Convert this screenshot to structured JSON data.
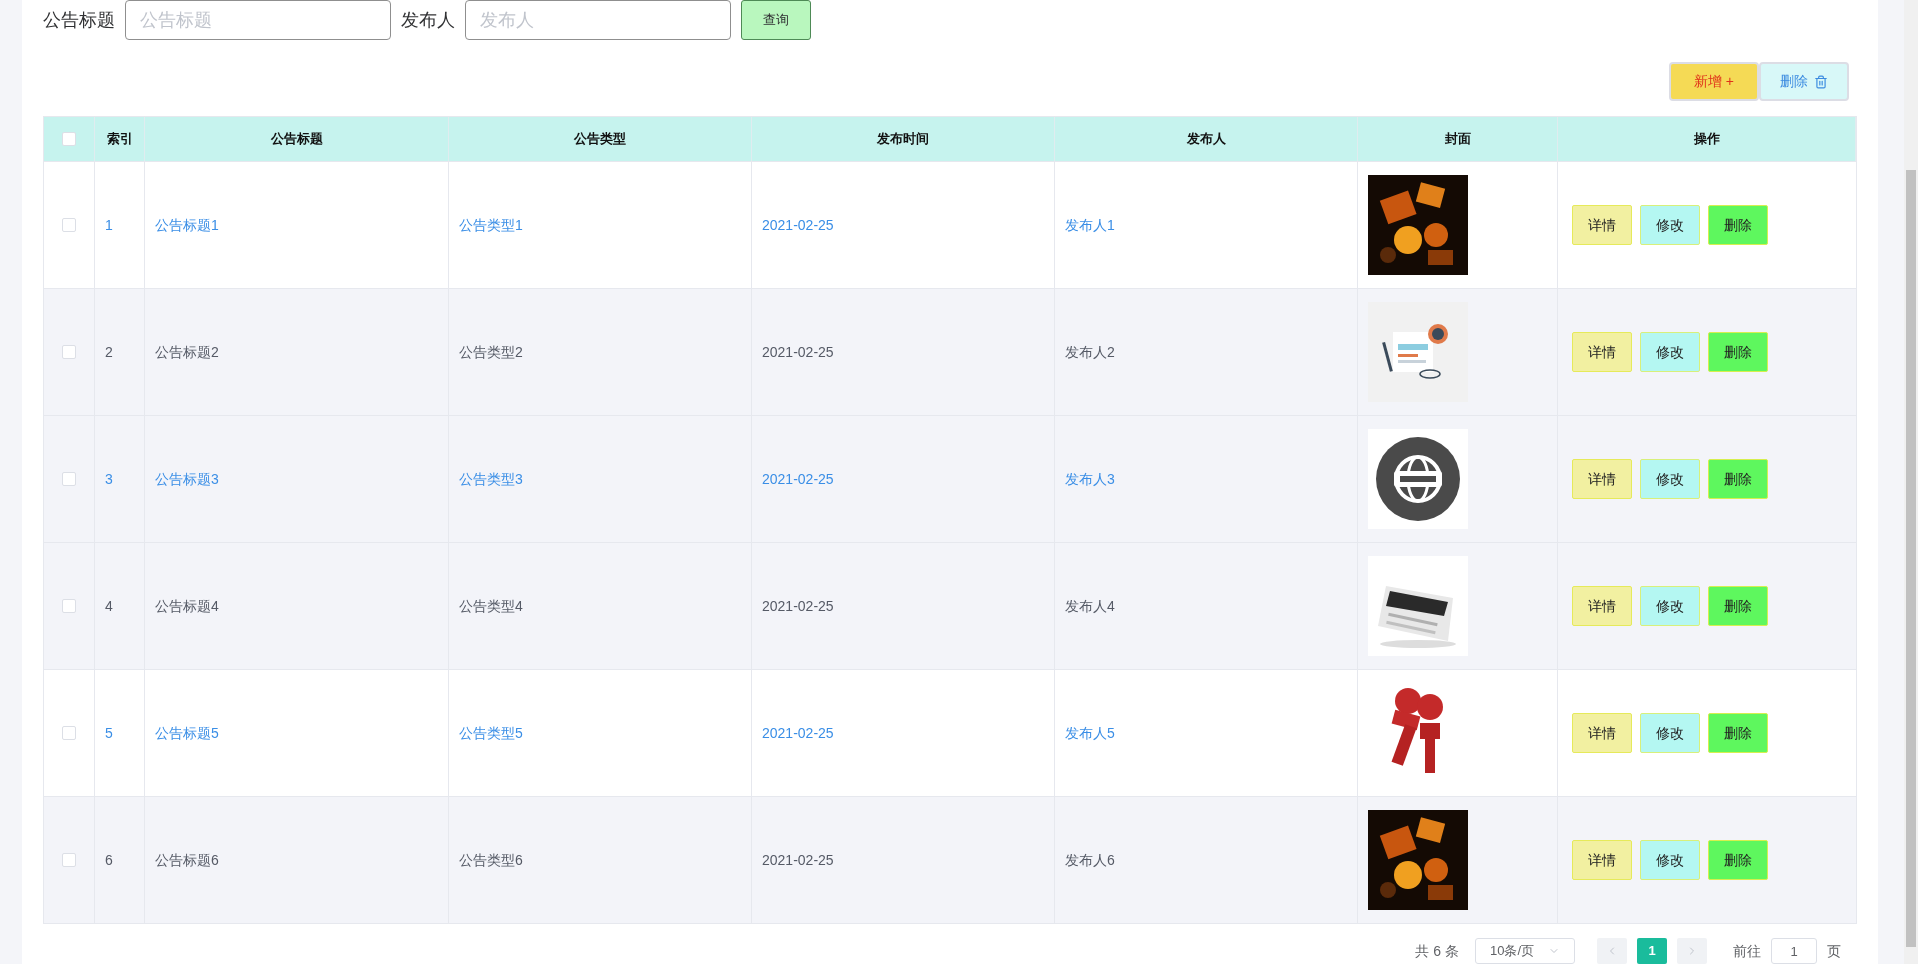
{
  "search": {
    "fields": [
      {
        "label": "公告标题",
        "placeholder": "公告标题"
      },
      {
        "label": "发布人",
        "placeholder": "发布人"
      }
    ],
    "button": "查询"
  },
  "toolbar": {
    "add_button": "新增 +",
    "delete_button": "删除"
  },
  "table": {
    "header_checkbox": {
      "checked": false
    },
    "columns": [
      "索引",
      "公告标题",
      "公告类型",
      "发布时间",
      "发布人",
      "封面",
      "操作"
    ],
    "rows": [
      {
        "checked": false,
        "shaded": false,
        "highlighted": true,
        "index": "1",
        "title": "公告标题1",
        "type": "公告类型1",
        "time": "2021-02-25",
        "publisher": "发布人1",
        "actions": [
          "详情",
          "修改",
          "删除"
        ]
      },
      {
        "checked": false,
        "shaded": true,
        "highlighted": false,
        "index": "2",
        "title": "公告标题2",
        "type": "公告类型2",
        "time": "2021-02-25",
        "publisher": "发布人2",
        "actions": [
          "详情",
          "修改",
          "删除"
        ]
      },
      {
        "checked": false,
        "shaded": true,
        "highlighted": true,
        "index": "3",
        "title": "公告标题3",
        "type": "公告类型3",
        "time": "2021-02-25",
        "publisher": "发布人3",
        "actions": [
          "详情",
          "修改",
          "删除"
        ]
      },
      {
        "checked": false,
        "shaded": true,
        "highlighted": false,
        "index": "4",
        "title": "公告标题4",
        "type": "公告类型4",
        "time": "2021-02-25",
        "publisher": "发布人4",
        "actions": [
          "详情",
          "修改",
          "删除"
        ]
      },
      {
        "checked": false,
        "shaded": false,
        "highlighted": true,
        "index": "5",
        "title": "公告标题5",
        "type": "公告类型5",
        "time": "2021-02-25",
        "publisher": "发布人5",
        "actions": [
          "详情",
          "修改",
          "删除"
        ]
      },
      {
        "checked": false,
        "shaded": true,
        "highlighted": false,
        "index": "6",
        "title": "公告标题6",
        "type": "公告类型6",
        "time": "2021-02-25",
        "publisher": "发布人6",
        "actions": [
          "详情",
          "修改",
          "删除"
        ]
      }
    ]
  },
  "pagination": {
    "total": "共 6 条",
    "page_size": "10条/页",
    "pages": [
      {
        "label": "1",
        "selected": true
      }
    ],
    "goto_label": "前往",
    "goto_value": "1",
    "goto_suffix": "页"
  }
}
